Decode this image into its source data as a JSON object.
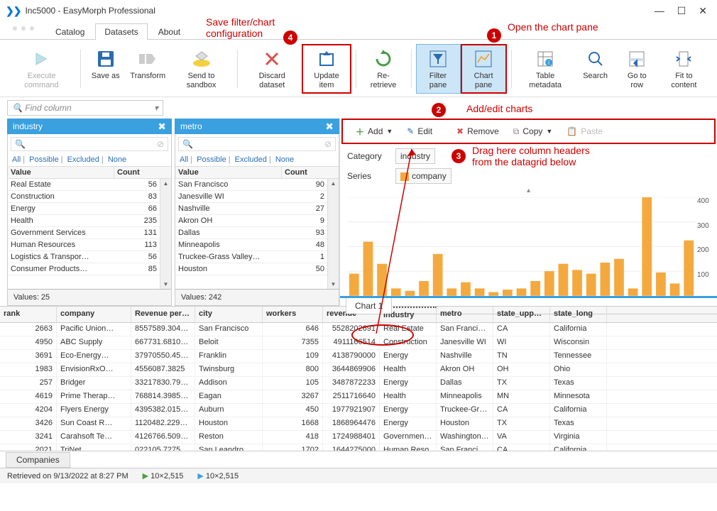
{
  "window": {
    "title": "Inc5000 - EasyMorph Professional"
  },
  "tabs": {
    "catalog": "Catalog",
    "datasets": "Datasets",
    "about": "About"
  },
  "ribbon": {
    "execute": "Execute\ncommand",
    "saveas": "Save as",
    "transform": "Transform",
    "sendto": "Send to\nsandbox",
    "discard": "Discard\ndataset",
    "update": "Update\nitem",
    "reretrieve": "Re-retrieve",
    "filterpane": "Filter\npane",
    "chartpane": "Chart\npane",
    "metadata": "Table\nmetadata",
    "search": "Search",
    "goto": "Go to\nrow",
    "fit": "Fit to\ncontent"
  },
  "findcol": {
    "placeholder": "Find column"
  },
  "filter_links": {
    "all": "All",
    "possible": "Possible",
    "excluded": "Excluded",
    "none": "None"
  },
  "filter_headers": {
    "value": "Value",
    "count": "Count"
  },
  "industry": {
    "title": "industry",
    "rows": [
      {
        "v": "Real Estate",
        "c": "56"
      },
      {
        "v": "Construction",
        "c": "83"
      },
      {
        "v": "Energy",
        "c": "66"
      },
      {
        "v": "Health",
        "c": "235"
      },
      {
        "v": "Government Services",
        "c": "131"
      },
      {
        "v": "Human Resources",
        "c": "113"
      },
      {
        "v": "Logistics & Transpor…",
        "c": "56"
      },
      {
        "v": "Consumer Products…",
        "c": "85"
      }
    ],
    "footer": "Values: 25"
  },
  "metro": {
    "title": "metro",
    "rows": [
      {
        "v": "San Francisco",
        "c": "90"
      },
      {
        "v": "Janesville WI",
        "c": "2"
      },
      {
        "v": "Nashville",
        "c": "27"
      },
      {
        "v": "Akron OH",
        "c": "9"
      },
      {
        "v": "Dallas",
        "c": "93"
      },
      {
        "v": "Minneapolis",
        "c": "48"
      },
      {
        "v": "Truckee-Grass Valley…",
        "c": "1"
      },
      {
        "v": "Houston",
        "c": "50"
      }
    ],
    "footer": "Values: 242"
  },
  "chartpane": {
    "add": "Add",
    "edit": "Edit",
    "remove": "Remove",
    "copy": "Copy",
    "paste": "Paste",
    "category_label": "Category",
    "category_value": "industry",
    "series_label": "Series",
    "series_value": "company",
    "tab1": "Chart 1"
  },
  "grid": {
    "headers": {
      "rank": "rank",
      "company": "company",
      "revenue_per": "Revenue per…",
      "city": "city",
      "workers": "workers",
      "revenue": "revenue",
      "industry": "industry",
      "metro": "metro",
      "state_upper": "state_upperc…",
      "state_long": "state_long"
    },
    "rows": [
      {
        "rank": "2663",
        "company": "Pacific Union…",
        "rev": "8557589.304…",
        "city": "San Francisco",
        "workers": "646",
        "r2": "5528202691",
        "ind": "Real Estate",
        "metro": "San Francisco",
        "su": "CA",
        "sl": "California"
      },
      {
        "rank": "4950",
        "company": "ABC Supply",
        "rev": "667731.6810…",
        "city": "Beloit",
        "workers": "7355",
        "r2": "4911166514",
        "ind": "Construction",
        "metro": "Janesville WI",
        "su": "WI",
        "sl": "Wisconsin"
      },
      {
        "rank": "3691",
        "company": "Eco-Energy…",
        "rev": "37970550.45…",
        "city": "Franklin",
        "workers": "109",
        "r2": "4138790000",
        "ind": "Energy",
        "metro": "Nashville",
        "su": "TN",
        "sl": "Tennessee"
      },
      {
        "rank": "1983",
        "company": "EnvisionRxO…",
        "rev": "4556087.3825",
        "city": "Twinsburg",
        "workers": "800",
        "r2": "3644869906",
        "ind": "Health",
        "metro": "Akron OH",
        "su": "OH",
        "sl": "Ohio"
      },
      {
        "rank": "257",
        "company": "Bridger",
        "rev": "33217830.79…",
        "city": "Addison",
        "workers": "105",
        "r2": "3487872233",
        "ind": "Energy",
        "metro": "Dallas",
        "su": "TX",
        "sl": "Texas"
      },
      {
        "rank": "4619",
        "company": "Prime Therap…",
        "rev": "768814.3985…",
        "city": "Eagan",
        "workers": "3267",
        "r2": "2511716640",
        "ind": "Health",
        "metro": "Minneapolis",
        "su": "MN",
        "sl": "Minnesota"
      },
      {
        "rank": "4204",
        "company": "Flyers Energy",
        "rev": "4395382.015…",
        "city": "Auburn",
        "workers": "450",
        "r2": "1977921907",
        "ind": "Energy",
        "metro": "Truckee-Gras…",
        "su": "CA",
        "sl": "California"
      },
      {
        "rank": "3426",
        "company": "Sun Coast R…",
        "rev": "1120482.229…",
        "city": "Houston",
        "workers": "1668",
        "r2": "1868964476",
        "ind": "Energy",
        "metro": "Houston",
        "su": "TX",
        "sl": "Texas"
      },
      {
        "rank": "3241",
        "company": "Carahsoft Te…",
        "rev": "4126766.509…",
        "city": "Reston",
        "workers": "418",
        "r2": "1724988401",
        "ind": "Government…",
        "metro": "Washington…",
        "su": "VA",
        "sl": "Virginia"
      },
      {
        "rank": "2021",
        "company": "TriNet",
        "rev": "022105 7275",
        "city": "San Leandro",
        "workers": "1702",
        "r2": "1644275000",
        "ind": "Human Reso",
        "metro": "San Francisco",
        "su": "CA",
        "sl": "California"
      }
    ]
  },
  "bottom": {
    "tab": "Companies"
  },
  "status": {
    "retrieved": "Retrieved on 9/13/2022 at 8:27 PM",
    "dim1": "10×2,515",
    "dim2": "10×2,515"
  },
  "annotations": {
    "a1": "Open the chart pane",
    "a2": "Add/edit charts",
    "a3": "Drag here column headers\nfrom the datagrid below",
    "a4": "Save filter/chart\nconfiguration"
  },
  "chart_data": {
    "type": "bar",
    "title": "",
    "xlabel": "",
    "ylabel": "",
    "ylim": [
      0,
      400
    ],
    "yticks": [
      100,
      200,
      300,
      400
    ],
    "values": [
      90,
      220,
      130,
      30,
      20,
      60,
      170,
      30,
      55,
      30,
      15,
      25,
      30,
      60,
      100,
      130,
      105,
      90,
      135,
      150,
      30,
      440,
      95,
      50,
      225
    ]
  }
}
